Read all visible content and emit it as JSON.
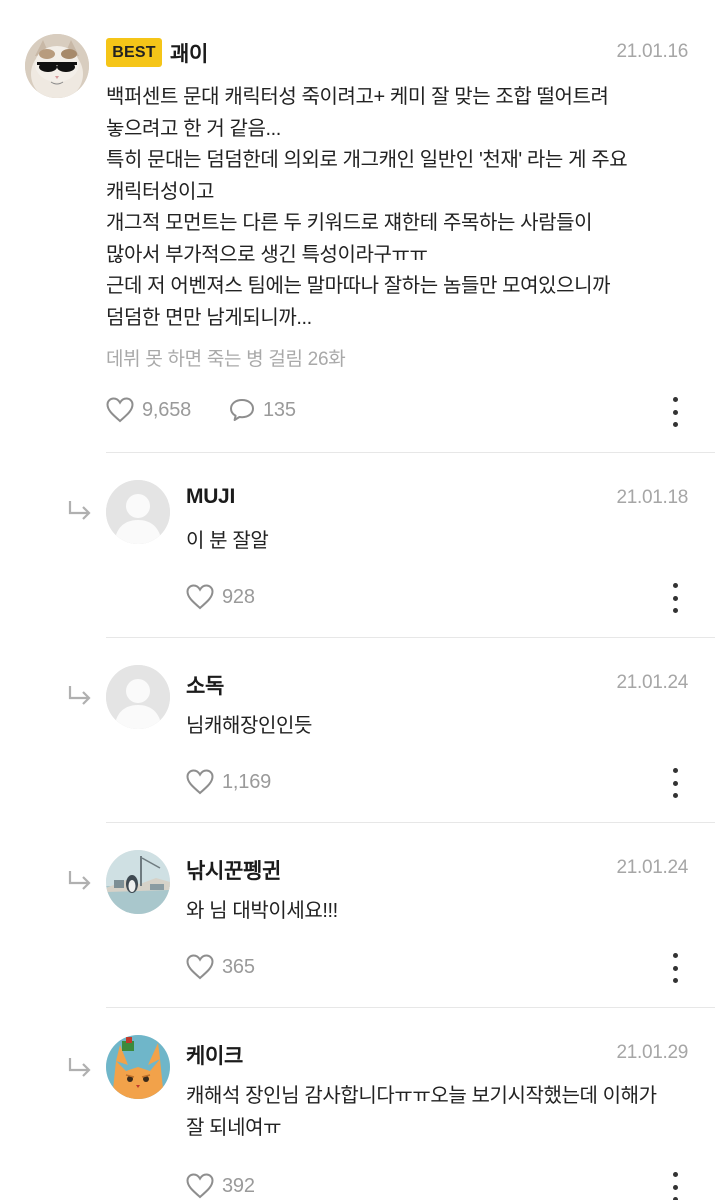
{
  "comments": [
    {
      "badge": "BEST",
      "author": "괘이",
      "date": "21.01.16",
      "text": "백퍼센트 문대 캐릭터성 죽이려고+ 케미 잘 맞는 조합 떨어트려\n놓으려고 한 거 같음...\n특히 문대는 덤덤한데 의외로 개그캐인 일반인 '천재' 라는 게 주요\n캐릭터성이고\n개그적 모먼트는 다른 두 키워드로 쟤한테 주목하는 사람들이\n많아서 부가적으로 생긴 특성이라구ㅠㅠ\n근데 저 어벤져스 팀에는 말마따나 잘하는 놈들만 모여있으니까\n덤덤한 면만 남게되니까...",
      "episode": "데뷔 못 하면 죽는 병 걸림 26화",
      "likes": "9,658",
      "replies": "135",
      "avatar_icon": "cat-sunglasses-avatar"
    },
    {
      "author": "MUJI",
      "date": "21.01.18",
      "text": "이 분 잘알",
      "likes": "928",
      "avatar_icon": "default-user-avatar"
    },
    {
      "author": "소독",
      "date": "21.01.24",
      "text": "님캐해장인인듯",
      "likes": "1,169",
      "avatar_icon": "default-user-avatar"
    },
    {
      "author": "낚시꾼펭귄",
      "date": "21.01.24",
      "text": "와 님 대박이세요!!!",
      "likes": "365",
      "avatar_icon": "penguin-photo-avatar"
    },
    {
      "author": "케이크",
      "date": "21.01.29",
      "text": "캐해석 장인님 감사합니다ㅠㅠ오늘 보기시작했는데 이해가\n잘 되네여ㅠ",
      "likes": "392",
      "avatar_icon": "orange-cat-avatar"
    }
  ],
  "icons": {
    "like": "heart-icon",
    "reply": "speech-bubble-icon",
    "more": "more-vertical-icon",
    "reply_indicator": "reply-arrow-icon"
  },
  "colors": {
    "best_badge": "#f5c518",
    "muted_text": "#a6a6a6",
    "divider": "#e7e7e7"
  }
}
